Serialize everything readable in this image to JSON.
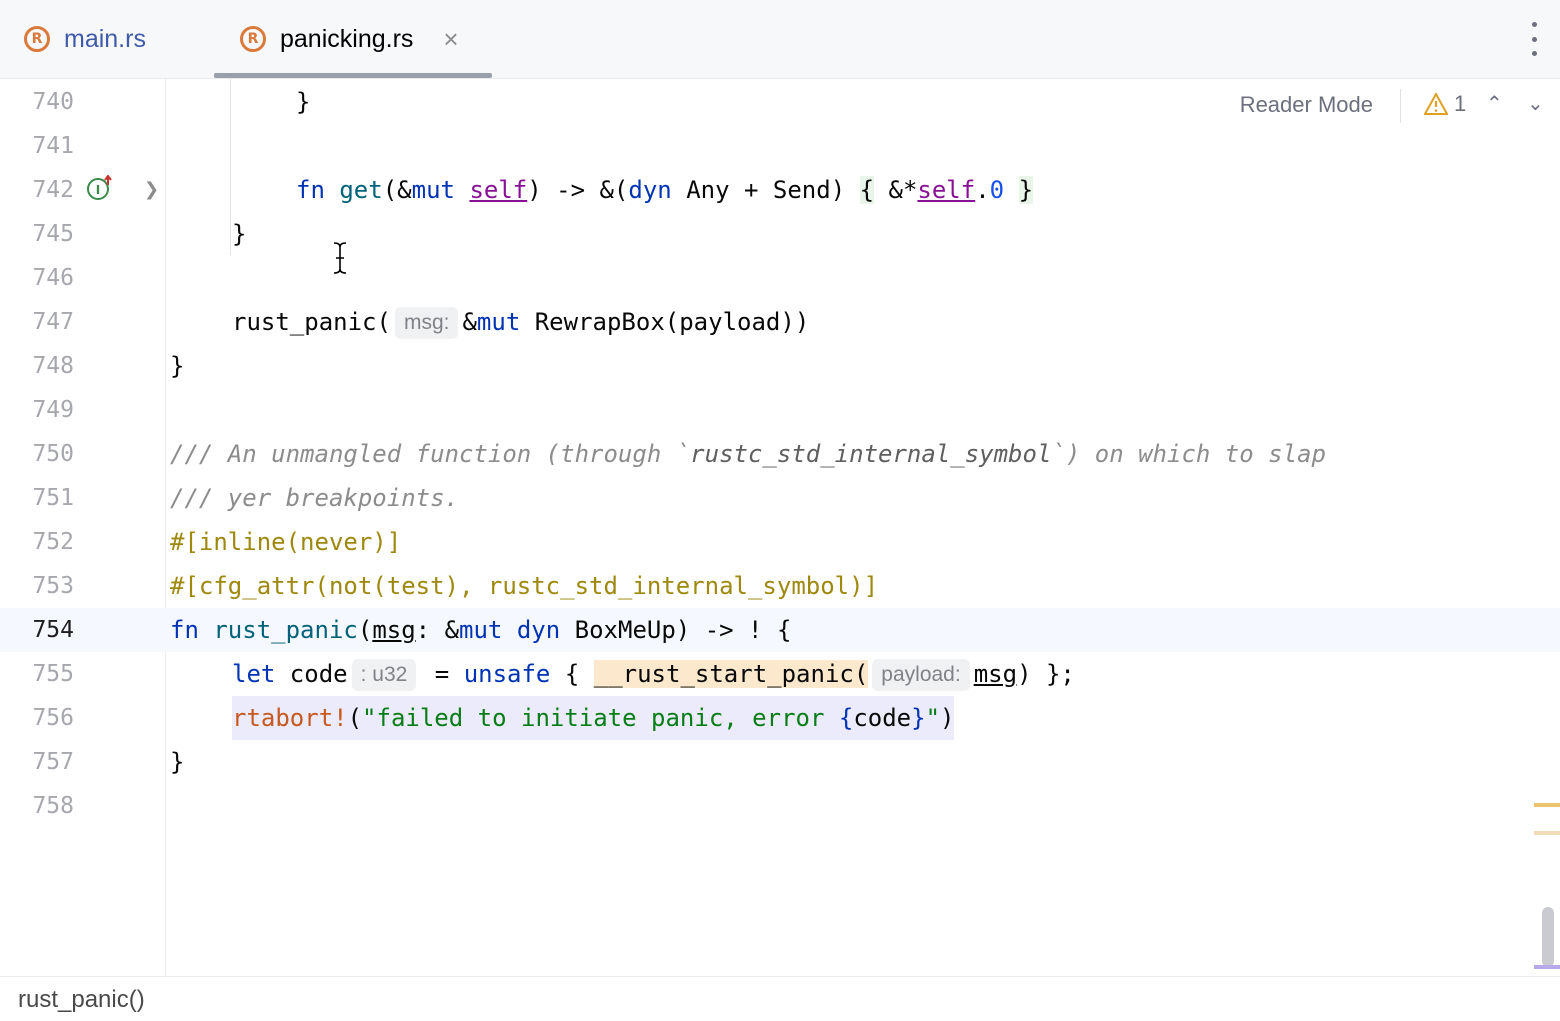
{
  "tabs": [
    {
      "label": "main.rs",
      "icon": "rust-file-icon",
      "active": false
    },
    {
      "label": "panicking.rs",
      "icon": "rust-file-icon",
      "active": true,
      "close": "×"
    }
  ],
  "toolbar": {
    "reader_mode": "Reader Mode",
    "warning_count": "1"
  },
  "lines": [
    {
      "n": "740"
    },
    {
      "n": "741"
    },
    {
      "n": "742"
    },
    {
      "n": "745"
    },
    {
      "n": "746"
    },
    {
      "n": "747"
    },
    {
      "n": "748"
    },
    {
      "n": "749"
    },
    {
      "n": "750"
    },
    {
      "n": "751"
    },
    {
      "n": "752"
    },
    {
      "n": "753"
    },
    {
      "n": "754"
    },
    {
      "n": "755"
    },
    {
      "n": "756"
    },
    {
      "n": "757"
    },
    {
      "n": "758"
    }
  ],
  "code": {
    "l740": "}",
    "l742_fn": "fn",
    "l742_get": "get",
    "l742_a": "(&",
    "l742_mut": "mut",
    "l742_self1": "self",
    "l742_b": ") -> &(",
    "l742_dyn": "dyn",
    "l742_c": " Any + Send) ",
    "l742_ob": "{",
    "l742_d": " &*",
    "l742_self2": "self",
    "l742_dot": ".",
    "l742_zero": "0",
    "l742_cb": "}",
    "l745": "}",
    "l747_call": "rust_panic(",
    "l747_hint": "msg:",
    "l747_amp": "&",
    "l747_mut": "mut",
    "l747_rest": " RewrapBox(payload))",
    "l748": "}",
    "l750_cmt1": "/// An unmangled function (through `",
    "l750_code": "rustc_std_internal_symbol",
    "l750_cmt2": "`) on which to slap",
    "l751": "/// yer breakpoints.",
    "l752": "#[inline(never)]",
    "l753": "#[cfg_attr(not(test), rustc_std_internal_symbol)]",
    "l754_fn": "fn",
    "l754_name": "rust_panic",
    "l754_p": "(",
    "l754_msg": "msg",
    "l754_colon": ": &",
    "l754_mut": "mut",
    "l754_dyn": "dyn",
    "l754_rest": " BoxMeUp) -> ! {",
    "l755_let": "let",
    "l755_code": " code",
    "l755_hint": ": u32",
    "l755_eq": " = ",
    "l755_unsafe": "unsafe",
    "l755_ob": " { ",
    "l755_panic": "__rust_start_panic(",
    "l755_hint2": "payload:",
    "l755_msg": "msg",
    "l755_end": ") };",
    "l756_macro": "rtabort!",
    "l756_p": "(",
    "l756_str1": "\"failed to initiate panic, error ",
    "l756_brace1": "{",
    "l756_var": "code",
    "l756_brace2": "}",
    "l756_str2": "\"",
    "l756_end": ")",
    "l757": "}"
  },
  "breadcrumb": "rust_panic()"
}
